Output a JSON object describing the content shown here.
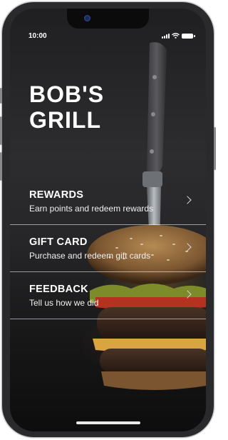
{
  "status_bar": {
    "time": "10:00"
  },
  "brand": {
    "line1": "BOB'S",
    "line2": "GRILL"
  },
  "menu": {
    "items": [
      {
        "title": "REWARDS",
        "subtitle": "Earn points and redeem rewards"
      },
      {
        "title": "GIFT CARD",
        "subtitle": "Purchase and redeem gift cards"
      },
      {
        "title": "FEEDBACK",
        "subtitle": "Tell us how we did"
      }
    ]
  },
  "colors": {
    "background": "#262628",
    "text": "#ffffff",
    "divider": "#ffffff"
  },
  "icons": [
    "signal-icon",
    "wifi-icon",
    "battery-icon",
    "chevron-right-icon"
  ]
}
